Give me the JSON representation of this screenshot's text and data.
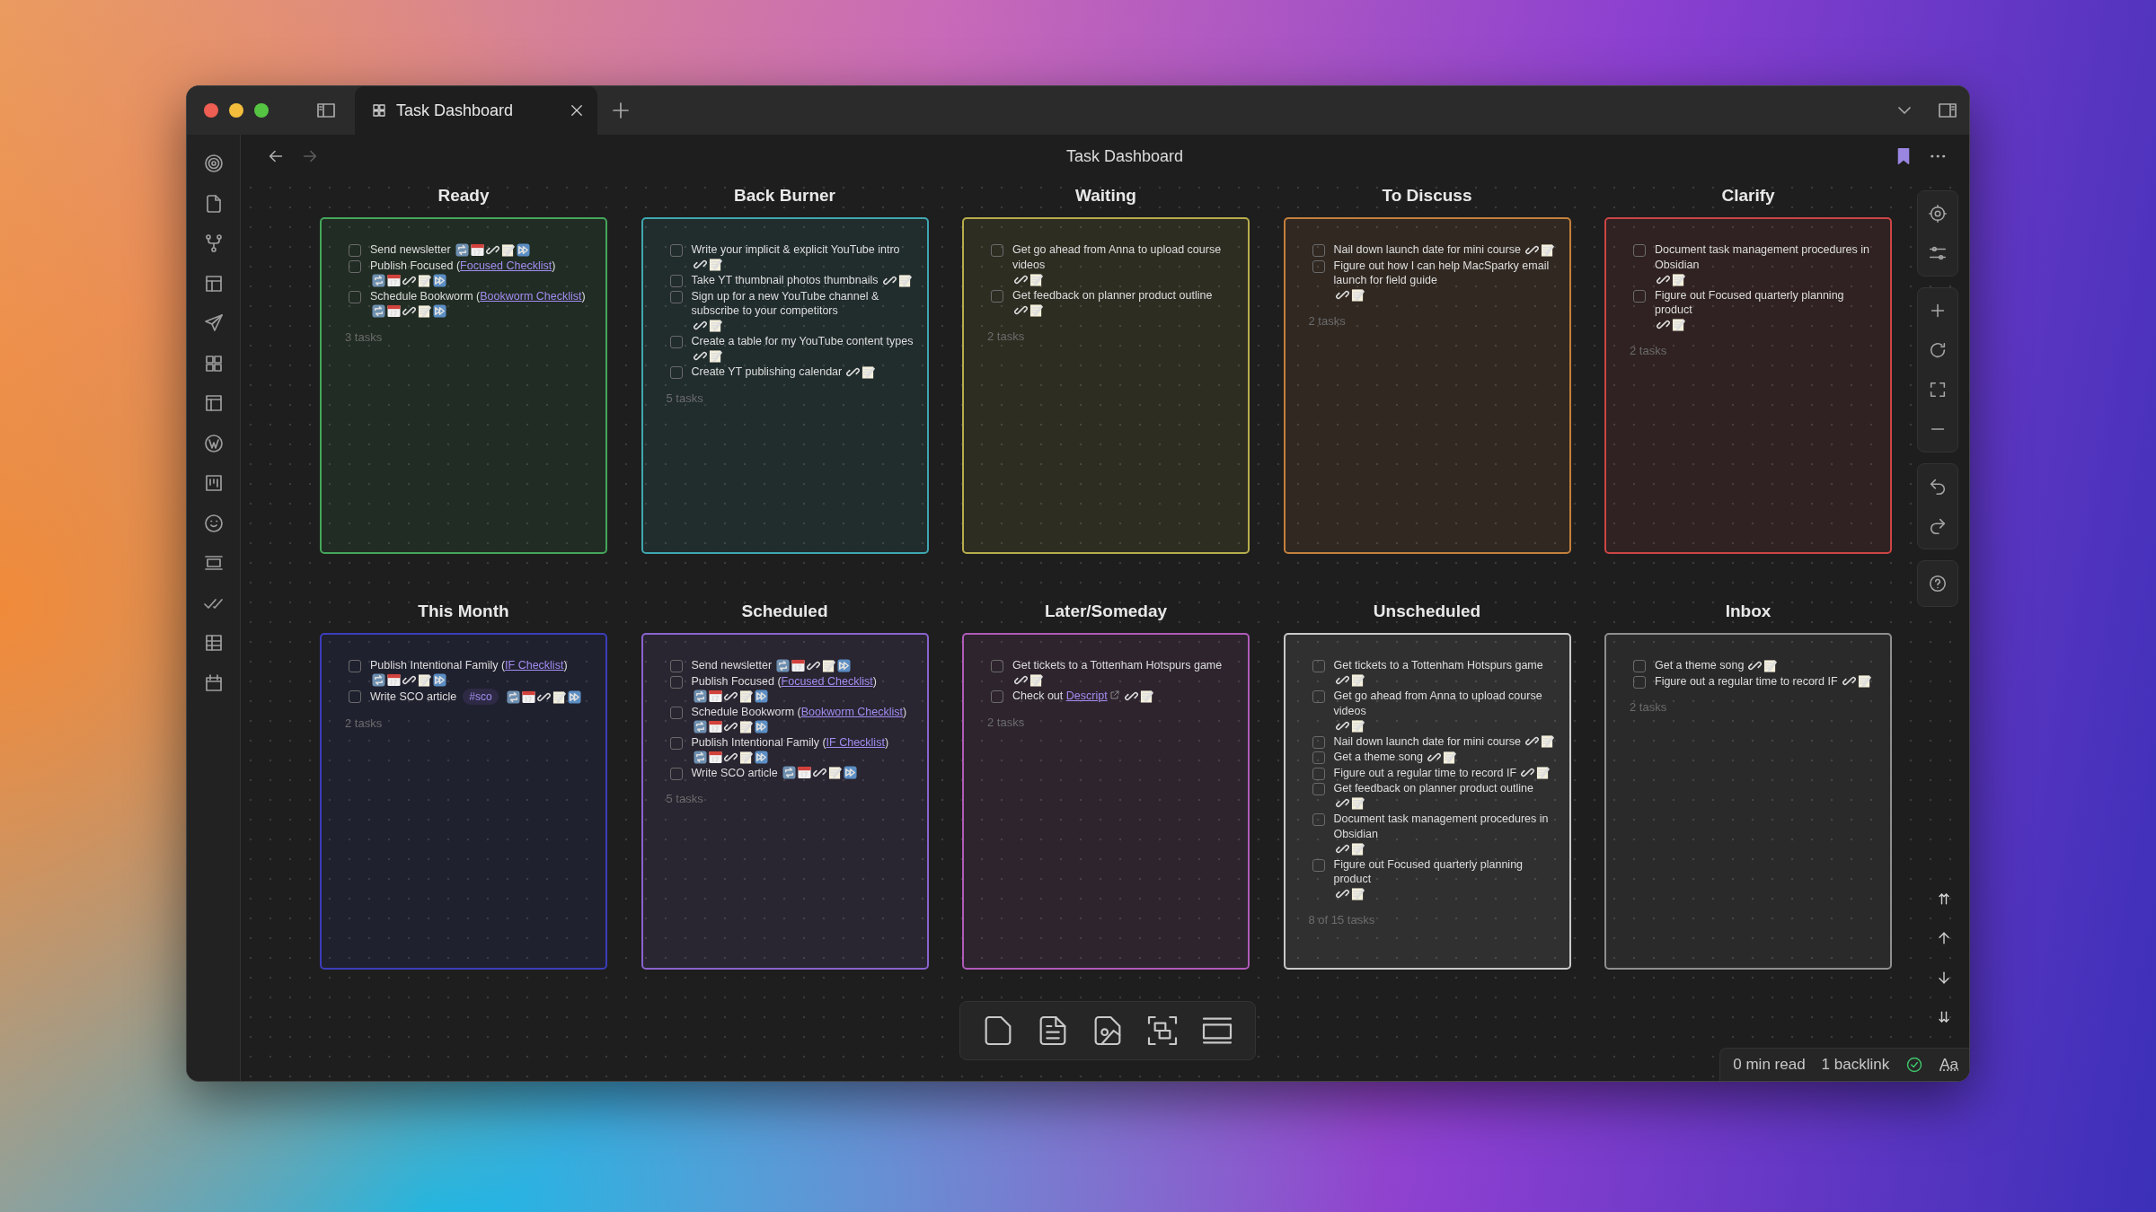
{
  "tabs": [
    {
      "title": "Task Dashboard",
      "selected": true
    }
  ],
  "title": "Task Dashboard",
  "columns": [
    {
      "title": "Ready",
      "color": "#44a65a",
      "count": "3 tasks",
      "tasks": [
        {
          "text": "Send newsletter",
          "kind": "recurring",
          "checked": false
        },
        {
          "text": "Publish Focused (",
          "link": {
            "label": "Focused Checklist",
            "external": false
          },
          "after": ")",
          "kind": "recurring",
          "checked": false
        },
        {
          "text": "Schedule Bookworm (",
          "link": {
            "label": "Bookworm Checklist",
            "external": false
          },
          "after": ")",
          "kind": "recurring",
          "checked": false
        }
      ]
    },
    {
      "title": "Back Burner",
      "color": "#3fa7b0",
      "count": "5 tasks",
      "tasks": [
        {
          "text": "Write your implicit & explicit YouTube intro",
          "kind": "note",
          "checked": false
        },
        {
          "text": "Take YT thumbnail photos thumbnails",
          "kind": "note",
          "checked": false
        },
        {
          "text": "Sign up for a new YouTube channel & subscribe to your competitors",
          "kind": "note",
          "checked": false
        },
        {
          "text": "Create a table for my YouTube content types",
          "kind": "note",
          "checked": false
        },
        {
          "text": "Create YT publishing calendar",
          "kind": "note",
          "checked": false
        }
      ]
    },
    {
      "title": "Waiting",
      "color": "#b6ad4c",
      "count": "2 tasks",
      "tasks": [
        {
          "text": "Get go ahead from Anna to upload course videos",
          "kind": "note",
          "checked": false
        },
        {
          "text": "Get feedback on planner product outline",
          "kind": "note",
          "checked": false
        }
      ]
    },
    {
      "title": "To Discuss",
      "color": "#c4803c",
      "count": "2 tasks",
      "tasks": [
        {
          "text": "Nail down launch date for mini course",
          "kind": "note",
          "checked": false
        },
        {
          "text": "Figure out how I can help MacSparky email launch for field guide",
          "kind": "note",
          "checked": false
        }
      ]
    },
    {
      "title": "Clarify",
      "color": "#cc4545",
      "count": "2 tasks",
      "tasks": [
        {
          "text": "Document task management procedures in Obsidian",
          "kind": "note",
          "checked": false
        },
        {
          "text": "Figure out Focused quarterly planning product",
          "kind": "note",
          "checked": false
        }
      ]
    },
    {
      "title": "This Month",
      "color": "#3b3dbb",
      "count": "2 tasks",
      "tasks": [
        {
          "text": "Publish Intentional Family (",
          "link": {
            "label": "IF Checklist",
            "external": false
          },
          "after": ")",
          "kind": "recurring",
          "checked": false
        },
        {
          "text": "Write SCO article",
          "tag": "#sco",
          "kind": "recurring",
          "checked": false
        }
      ]
    },
    {
      "title": "Scheduled",
      "color": "#8a63cf",
      "count": "5 tasks",
      "tasks": [
        {
          "text": "Send newsletter",
          "kind": "recurring",
          "checked": false
        },
        {
          "text": "Publish Focused (",
          "link": {
            "label": "Focused Checklist",
            "external": false
          },
          "after": ")",
          "kind": "recurring",
          "checked": false
        },
        {
          "text": "Schedule Bookworm (",
          "link": {
            "label": "Bookworm Checklist",
            "external": false
          },
          "after": ")",
          "kind": "recurring",
          "checked": false
        },
        {
          "text": "Publish Intentional Family (",
          "link": {
            "label": "IF Checklist",
            "external": false
          },
          "after": ")",
          "kind": "recurring",
          "checked": false
        },
        {
          "text": "Write SCO article",
          "kind": "recurring",
          "checked": false
        }
      ]
    },
    {
      "title": "Later/Someday",
      "color": "#b05ab9",
      "count": "2 tasks",
      "tasks": [
        {
          "text": "Get tickets to a Tottenham Hotspurs game",
          "kind": "note",
          "checked": false
        },
        {
          "text": "Check out ",
          "link": {
            "label": "Descript",
            "external": true
          },
          "kind": "note",
          "checked": false
        }
      ]
    },
    {
      "title": "Unscheduled",
      "color": "#c9c9c9",
      "count": "8 of 15 tasks",
      "tasks": [
        {
          "text": "Get tickets to a Tottenham Hotspurs game",
          "kind": "note",
          "checked": false
        },
        {
          "text": "Get go ahead from Anna to upload course videos",
          "kind": "note",
          "checked": false
        },
        {
          "text": "Nail down launch date for mini course",
          "kind": "note",
          "checked": false
        },
        {
          "text": "Get a theme song",
          "kind": "note",
          "checked": false
        },
        {
          "text": "Figure out a regular time to record IF",
          "kind": "note",
          "checked": false
        },
        {
          "text": "Get feedback on planner product outline",
          "kind": "note",
          "checked": false
        },
        {
          "text": "Document task management procedures in Obsidian",
          "kind": "note",
          "checked": false
        },
        {
          "text": "Figure out Focused quarterly planning product",
          "kind": "note",
          "checked": false
        }
      ]
    },
    {
      "title": "Inbox",
      "color": "#8f8f8f",
      "count": "2 tasks",
      "tasks": [
        {
          "text": "Get a theme song",
          "kind": "note",
          "checked": false
        },
        {
          "text": "Figure out a regular time to record IF",
          "kind": "note",
          "checked": false
        }
      ]
    }
  ],
  "status_bar": {
    "reading_time": "0 min read",
    "backlinks": "1 backlink",
    "font_button": "Aa"
  }
}
